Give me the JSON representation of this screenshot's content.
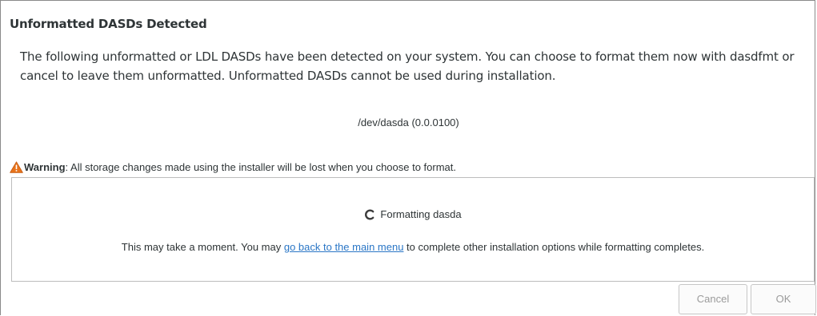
{
  "dialog": {
    "title": "Unformatted DASDs Detected",
    "description": "The following unformatted or LDL DASDs have been detected on your system. You can choose to format them now with dasdfmt or cancel to leave them unformatted. Unformatted DASDs cannot be used during installation.",
    "device": "/dev/dasda (0.0.0100)",
    "warning": {
      "icon": "warning-triangle-icon",
      "label": "Warning",
      "text": ": All storage changes made using the installer will be lost when you choose to format."
    },
    "progress": {
      "icon": "spinner-icon",
      "status": "Formatting dasda",
      "note_before": "This may take a moment. You may ",
      "link": "go back to the main menu",
      "note_after": " to complete other installation options while formatting completes."
    },
    "buttons": {
      "cancel": "Cancel",
      "ok": "OK"
    }
  },
  "colors": {
    "link": "#2a76c6",
    "warning_icon": "#e8731b",
    "disabled_text": "#9b9b9b"
  }
}
